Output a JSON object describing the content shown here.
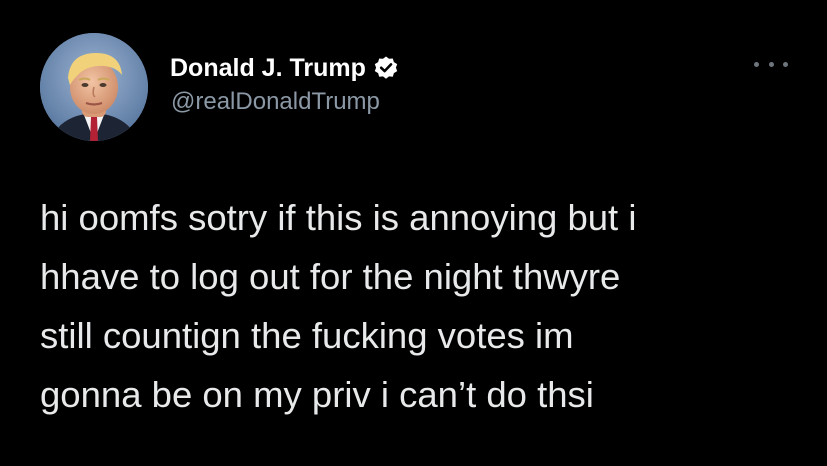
{
  "author": {
    "display_name": "Donald J. Trump",
    "handle": "@realDonaldTrump",
    "verified": true,
    "avatar_icon": "profile-photo",
    "verified_icon": "verified-badge-icon"
  },
  "tweet": {
    "lines": [
      "hi oomfs sotry if this is annoying but i",
      "hhave to log out for the night thwyre",
      "still countign the fucking votes im",
      "gonna be on my priv i can’t do thsi"
    ]
  },
  "menu": {
    "icon": "more-options-icon"
  },
  "colors": {
    "background": "#000000",
    "name": "#ffffff",
    "handle": "#8b98a5",
    "text": "#e7e9ea",
    "verified_badge": "#ffffff"
  }
}
